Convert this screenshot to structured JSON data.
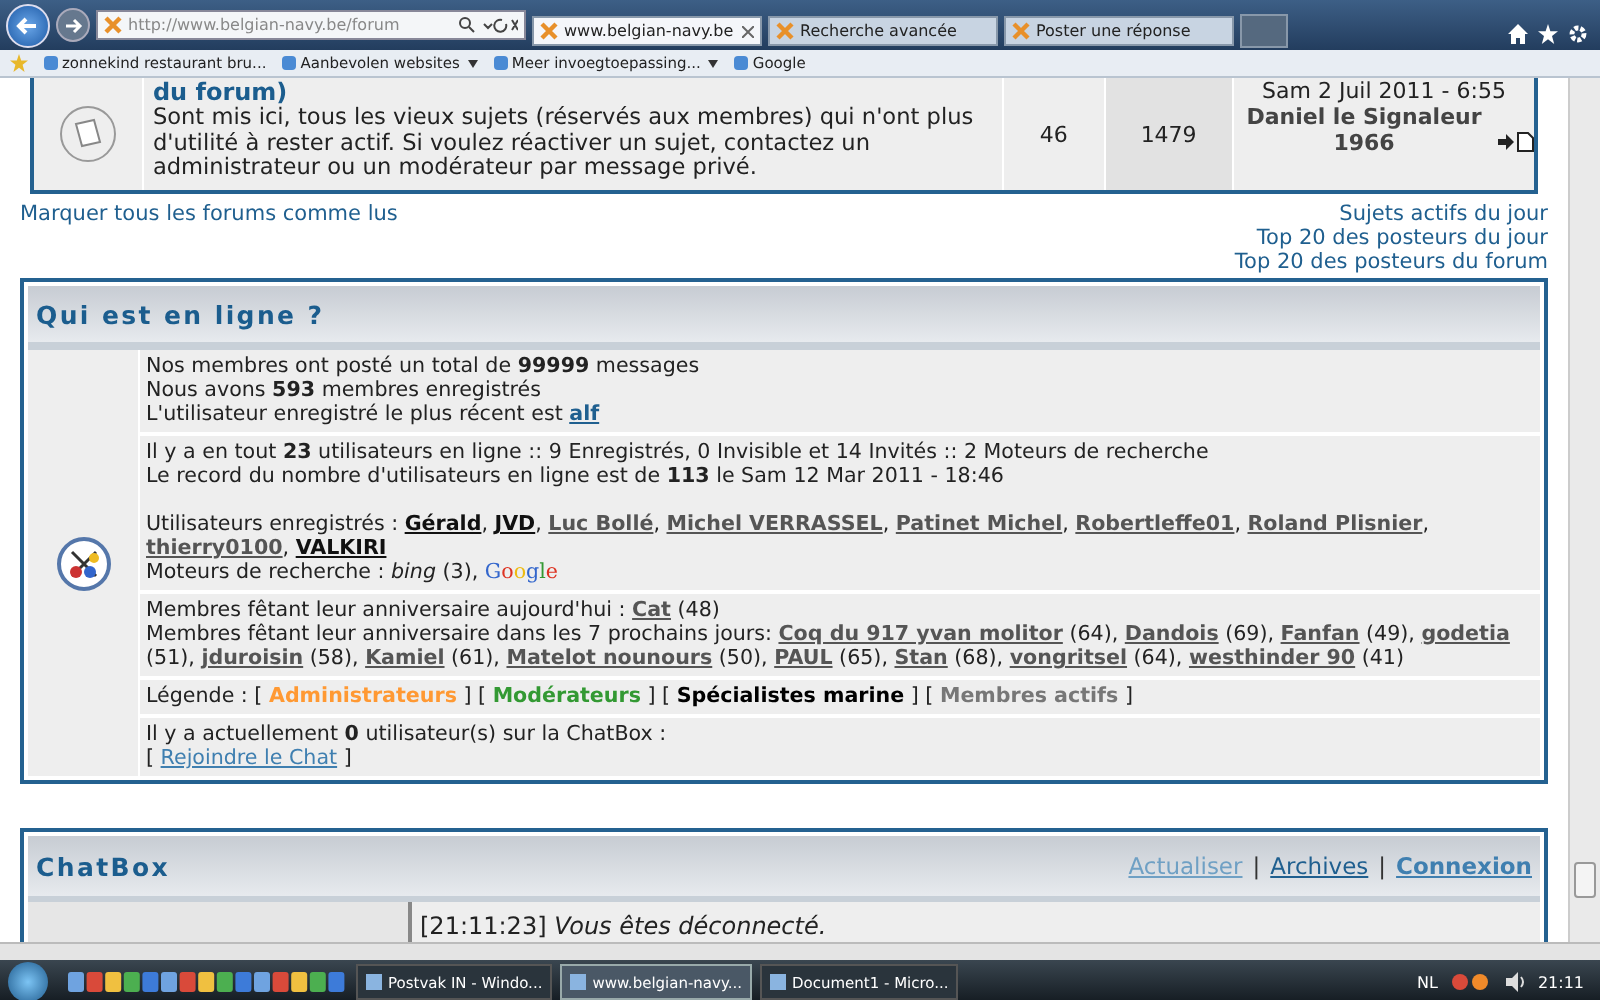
{
  "browser": {
    "address": "http://www.belgian-navy.be/forum",
    "tabs": [
      {
        "label": "www.belgian-navy.be",
        "selected": true
      },
      {
        "label": "Recherche avancée",
        "selected": false
      },
      {
        "label": "Poster une réponse",
        "selected": false
      }
    ],
    "favorites": [
      {
        "label": "zonnekind restaurant bru...",
        "dropdown": false
      },
      {
        "label": "Aanbevolen websites",
        "dropdown": true
      },
      {
        "label": "Meer invoegtoepassing...",
        "dropdown": true
      },
      {
        "label": "Google",
        "dropdown": false
      }
    ]
  },
  "forum_row": {
    "title": "du forum)",
    "description": "Sont mis ici, tous les vieux sujets (réservés aux membres) qui n'ont plus d'utilité à rester actif. Si voulez réactiver un sujet, contactez un administrateur ou un modérateur par message privé.",
    "topics": "46",
    "posts": "1479",
    "last_post_date": "Sam 2 Juil 2011 - 6:55",
    "last_post_author": "Daniel le Signaleur 1966"
  },
  "left_links": [
    "Marquer tous les forums comme lus"
  ],
  "right_links": [
    "Sujets actifs du jour",
    "Top 20 des posteurs du jour",
    "Top 20 des posteurs du forum"
  ],
  "online": {
    "title": "Qui est en ligne ?",
    "sections": [
      {
        "lines": [
          {
            "segments": [
              {
                "kind": "text",
                "text": "Nos membres ont posté un total de "
              },
              {
                "kind": "strong",
                "text": "99999"
              },
              {
                "kind": "text",
                "text": " messages"
              }
            ]
          },
          {
            "segments": [
              {
                "kind": "text",
                "text": "Nous avons "
              },
              {
                "kind": "strong",
                "text": "593"
              },
              {
                "kind": "text",
                "text": " membres enregistrés"
              }
            ]
          },
          {
            "segments": [
              {
                "kind": "text",
                "text": "L'utilisateur enregistré le plus récent est "
              },
              {
                "kind": "link",
                "text": "alf"
              }
            ]
          }
        ]
      },
      {
        "paragraphs": [
          {
            "lines": [
              {
                "segments": [
                  {
                    "kind": "text",
                    "text": "Il y a en tout "
                  },
                  {
                    "kind": "strong",
                    "text": "23"
                  },
                  {
                    "kind": "text",
                    "text": " utilisateurs en ligne :: 9 Enregistrés, 0 Invisible et 14 Invités :: 2 Moteurs de recherche"
                  }
                ]
              },
              {
                "segments": [
                  {
                    "kind": "text",
                    "text": "Le record du nombre d'utilisateurs en ligne est de "
                  },
                  {
                    "kind": "strong",
                    "text": "113"
                  },
                  {
                    "kind": "text",
                    "text": " le Sam 12 Mar 2011 - 18:46"
                  }
                ]
              }
            ]
          },
          {
            "lines": [
              {
                "segments": [
                  {
                    "kind": "text",
                    "text": "Utilisateurs enregistrés : "
                  },
                  {
                    "kind": "user",
                    "text": "Gérald"
                  },
                  {
                    "kind": "text",
                    "text": ", "
                  },
                  {
                    "kind": "user",
                    "text": "JVD"
                  },
                  {
                    "kind": "text",
                    "text": ", "
                  },
                  {
                    "kind": "member",
                    "text": "Luc Bollé"
                  },
                  {
                    "kind": "text",
                    "text": ", "
                  },
                  {
                    "kind": "member",
                    "text": "Michel VERRASSEL"
                  },
                  {
                    "kind": "text",
                    "text": ", "
                  },
                  {
                    "kind": "member",
                    "text": "Patinet Michel"
                  },
                  {
                    "kind": "text",
                    "text": ", "
                  },
                  {
                    "kind": "member",
                    "text": "Robertleffe01"
                  },
                  {
                    "kind": "text",
                    "text": ", "
                  },
                  {
                    "kind": "member",
                    "text": "Roland Plisnier"
                  },
                  {
                    "kind": "text",
                    "text": ", "
                  },
                  {
                    "kind": "member",
                    "text": "thierry0100"
                  },
                  {
                    "kind": "text",
                    "text": ", "
                  },
                  {
                    "kind": "user",
                    "text": "VALKIRI"
                  }
                ]
              },
              {
                "segments": [
                  {
                    "kind": "text",
                    "text": "Moteurs de recherche : "
                  },
                  {
                    "kind": "em",
                    "text": "bing"
                  },
                  {
                    "kind": "text",
                    "text": " (3), "
                  },
                  {
                    "kind": "google",
                    "text": "Google"
                  }
                ]
              }
            ]
          }
        ]
      },
      {
        "lines": [
          {
            "segments": [
              {
                "kind": "text",
                "text": "Membres fêtant leur anniversaire aujourd'hui : "
              },
              {
                "kind": "member",
                "text": "Cat"
              },
              {
                "kind": "text",
                "text": " (48)"
              }
            ]
          },
          {
            "segments": [
              {
                "kind": "text",
                "text": "Membres fêtant leur anniversaire dans les 7 prochains jours: "
              },
              {
                "kind": "member",
                "text": "Coq du 917 yvan molitor"
              },
              {
                "kind": "text",
                "text": " (64), "
              },
              {
                "kind": "member",
                "text": "Dandois"
              },
              {
                "kind": "text",
                "text": " (69), "
              },
              {
                "kind": "member",
                "text": "Fanfan"
              },
              {
                "kind": "text",
                "text": " (49), "
              },
              {
                "kind": "member",
                "text": "godetia"
              },
              {
                "kind": "text",
                "text": " (51), "
              },
              {
                "kind": "member",
                "text": "jduroisin"
              },
              {
                "kind": "text",
                "text": " (58), "
              },
              {
                "kind": "member",
                "text": "Kamiel"
              },
              {
                "kind": "text",
                "text": " (61), "
              },
              {
                "kind": "member",
                "text": "Matelot nounours"
              },
              {
                "kind": "text",
                "text": " (50), "
              },
              {
                "kind": "member",
                "text": "PAUL"
              },
              {
                "kind": "text",
                "text": " (65), "
              },
              {
                "kind": "member",
                "text": "Stan"
              },
              {
                "kind": "text",
                "text": " (68), "
              },
              {
                "kind": "member",
                "text": "vongritsel"
              },
              {
                "kind": "text",
                "text": " (64), "
              },
              {
                "kind": "member",
                "text": "westhinder 90"
              },
              {
                "kind": "text",
                "text": " (41)"
              }
            ]
          }
        ]
      },
      {
        "lines": [
          {
            "segments": [
              {
                "kind": "text",
                "text": "Légende :  [ "
              },
              {
                "kind": "role",
                "text": "Administrateurs",
                "color": "#ff9933"
              },
              {
                "kind": "text",
                "text": " ] [ "
              },
              {
                "kind": "role",
                "text": "Modérateurs",
                "color": "#339933"
              },
              {
                "kind": "text",
                "text": " ] [ "
              },
              {
                "kind": "role",
                "text": "Spécialistes marine",
                "color": "#000000"
              },
              {
                "kind": "text",
                "text": " ] [ "
              },
              {
                "kind": "role",
                "text": "Membres actifs",
                "color": "#777777"
              },
              {
                "kind": "text",
                "text": " ]"
              }
            ]
          }
        ]
      },
      {
        "lines": [
          {
            "segments": [
              {
                "kind": "text",
                "text": "Il y a actuellement "
              },
              {
                "kind": "strong",
                "text": "0"
              },
              {
                "kind": "text",
                "text": " utilisateur(s) sur la ChatBox :"
              }
            ]
          },
          {
            "segments": [
              {
                "kind": "text",
                "text": "[ "
              },
              {
                "kind": "chatlink",
                "text": "Rejoindre le Chat"
              },
              {
                "kind": "text",
                "text": " ]"
              }
            ]
          }
        ]
      }
    ]
  },
  "chatbox": {
    "title": "ChatBox",
    "actions": [
      {
        "kind": "light",
        "label": "Actualiser"
      },
      {
        "kind": "separator",
        "label": "|"
      },
      {
        "kind": "normal",
        "label": "Archives"
      },
      {
        "kind": "separator",
        "label": "|"
      },
      {
        "kind": "bold",
        "label": "Connexion"
      }
    ],
    "messages": [
      {
        "time": "[21:11:23]",
        "text": "Vous êtes déconnecté."
      }
    ]
  },
  "taskbar": {
    "tasks": [
      {
        "label": "Postvak IN - Windo...",
        "selected": false
      },
      {
        "label": "www.belgian-navy...",
        "selected": true
      },
      {
        "label": "Document1 - Micro...",
        "selected": false
      }
    ],
    "language": "NL",
    "clock": "21:11"
  }
}
